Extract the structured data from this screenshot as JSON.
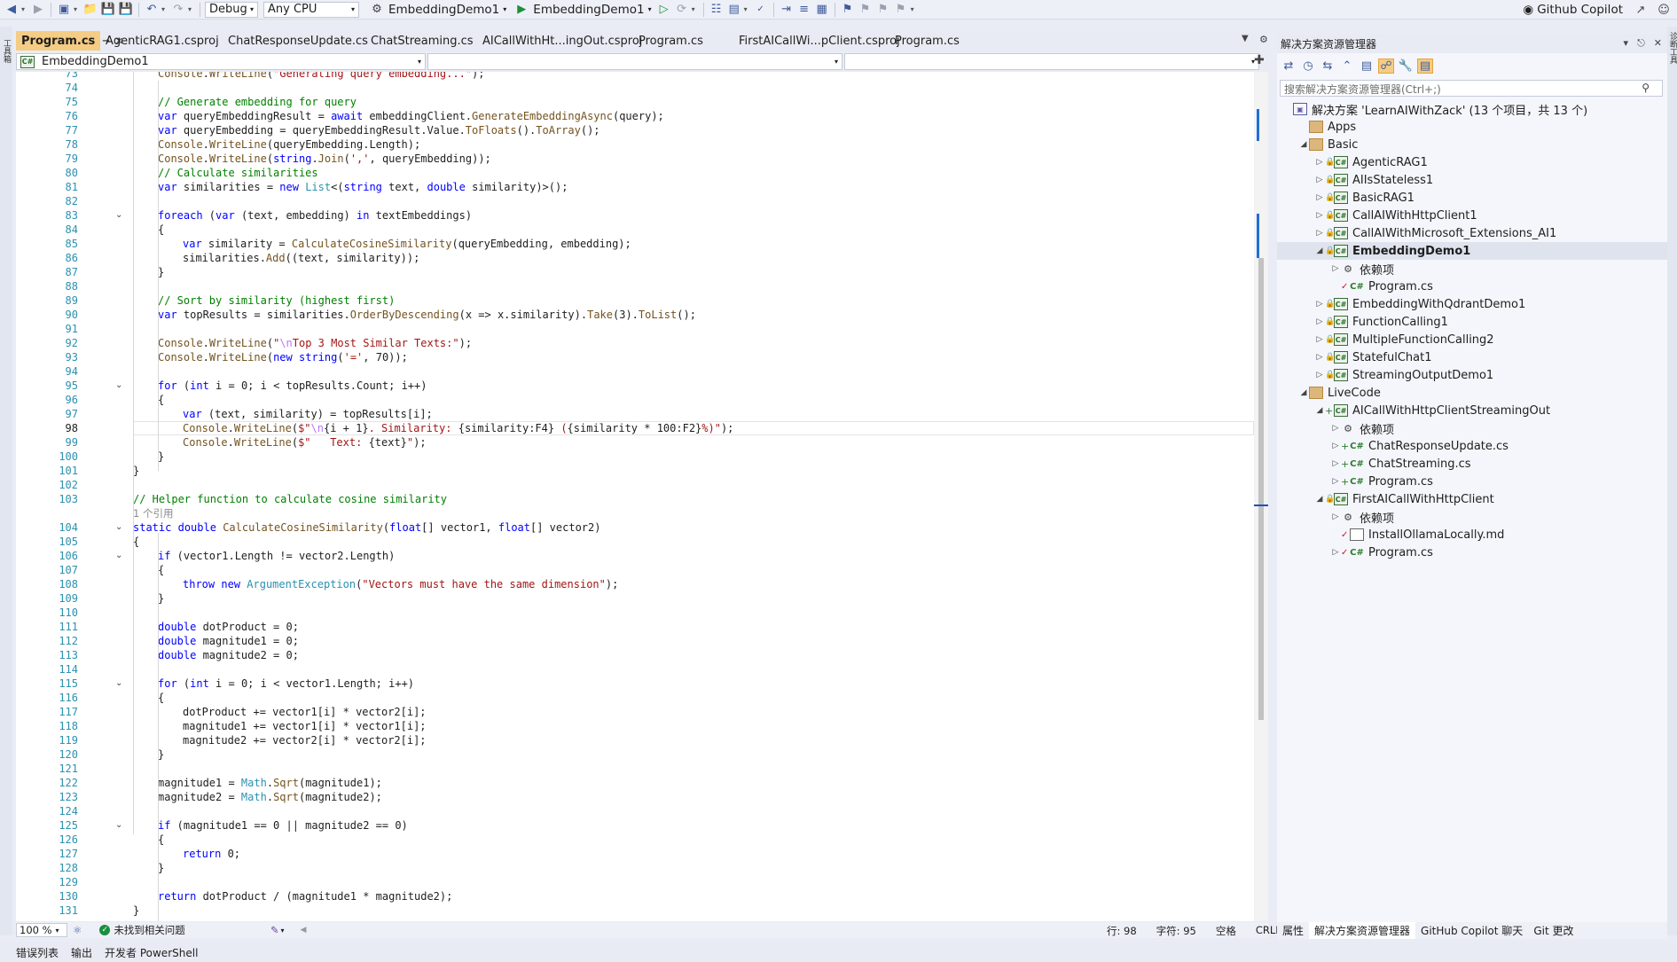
{
  "toolbar": {
    "config": "Debug",
    "platform": "Any CPU",
    "startup_project": "EmbeddingDemo1",
    "run_target": "EmbeddingDemo1",
    "copilot": "Github Copilot"
  },
  "left_strip_label": "工具箱",
  "right_strip_label": "诊断工具",
  "editor": {
    "tabs": [
      {
        "label": "Program.cs",
        "active": true
      },
      {
        "label": "AgenticRAG1.csproj"
      },
      {
        "label": "ChatResponseUpdate.cs"
      },
      {
        "label": "ChatStreaming.cs"
      },
      {
        "label": "AICallWithHt...ingOut.csproj"
      },
      {
        "label": "Program.cs"
      },
      {
        "label": "FirstAICallWi...pClient.csproj"
      },
      {
        "label": "Program.cs"
      }
    ],
    "nav_project": "EmbeddingDemo1",
    "zoom": "100 %",
    "issues": "未找到相关问题",
    "cursor": {
      "line": "行: 98",
      "col": "字符: 95",
      "ws": "空格",
      "eol": "CRLF"
    },
    "current_line": 98,
    "lines": [
      {
        "n": 73,
        "i": 1,
        "c": "<f>Console</f>.<f>WriteLine</f>(<s>\"Generating query embedding...\"</s>);"
      },
      {
        "n": 74,
        "i": 0,
        "c": ""
      },
      {
        "n": 75,
        "i": 1,
        "c": "<c>// Generate embedding for query</c>"
      },
      {
        "n": 76,
        "i": 1,
        "c": "<k>var</k> queryEmbeddingResult = <k>await</k> embeddingClient.<f>GenerateEmbeddingAsync</f>(query);"
      },
      {
        "n": 77,
        "i": 1,
        "c": "<k>var</k> queryEmbedding = queryEmbeddingResult.Value.<f>ToFloats</f>().<f>ToArray</f>();"
      },
      {
        "n": 78,
        "i": 1,
        "c": "<f>Console</f>.<f>WriteLine</f>(queryEmbedding.Length);"
      },
      {
        "n": 79,
        "i": 1,
        "c": "<f>Console</f>.<f>WriteLine</f>(<k>string</k>.<f>Join</f>(<s>','</s>, queryEmbedding));"
      },
      {
        "n": 80,
        "i": 1,
        "c": "<c>// Calculate similarities</c>"
      },
      {
        "n": 81,
        "i": 1,
        "c": "<k>var</k> similarities = <k>new</k> <t>List</t>&lt;(<k>string</k> text, <k>double</k> similarity)&gt;();"
      },
      {
        "n": 82,
        "i": 0,
        "c": ""
      },
      {
        "n": 83,
        "i": 1,
        "c": "<k>foreach</k> (<k>var</k> (text, embedding) <k>in</k> textEmbeddings)",
        "fold": true
      },
      {
        "n": 84,
        "i": 1,
        "c": "{"
      },
      {
        "n": 85,
        "i": 2,
        "c": "<k>var</k> similarity = <f>CalculateCosineSimilarity</f>(queryEmbedding, embedding);"
      },
      {
        "n": 86,
        "i": 2,
        "c": "similarities.<f>Add</f>((text, similarity));"
      },
      {
        "n": 87,
        "i": 1,
        "c": "}"
      },
      {
        "n": 88,
        "i": 0,
        "c": ""
      },
      {
        "n": 89,
        "i": 1,
        "c": "<c>// Sort by similarity (highest first)</c>"
      },
      {
        "n": 90,
        "i": 1,
        "c": "<k>var</k> topResults = similarities.<f>OrderByDescending</f>(x =&gt; x.similarity).<f>Take</f>(3).<f>ToList</f>();"
      },
      {
        "n": 91,
        "i": 0,
        "c": ""
      },
      {
        "n": 92,
        "i": 1,
        "c": "<f>Console</f>.<f>WriteLine</f>(<s>\"<e>\\n</e>Top 3 Most Similar Texts:\"</s>);"
      },
      {
        "n": 93,
        "i": 1,
        "c": "<f>Console</f>.<f>WriteLine</f>(<k>new</k> <k>string</k>(<s>'='</s>, 70));"
      },
      {
        "n": 94,
        "i": 0,
        "c": ""
      },
      {
        "n": 95,
        "i": 1,
        "c": "<k>for</k> (<k>int</k> i = 0; i &lt; topResults.Count; i++)",
        "fold": true
      },
      {
        "n": 96,
        "i": 1,
        "c": "{"
      },
      {
        "n": 97,
        "i": 2,
        "c": "<k>var</k> (text, similarity) = topResults[i];"
      },
      {
        "n": 98,
        "i": 2,
        "c": "<f>Console</f>.<f>WriteLine</f>(<s>$\"<e>\\n</e></s>{i + 1}<s>. Similarity: </s>{similarity:F4}<s> (</s>{similarity * 100:F2}<s>%)\"</s>);"
      },
      {
        "n": 99,
        "i": 2,
        "c": "<f>Console</f>.<f>WriteLine</f>(<s>$\"   Text: </s>{text}<s>\"</s>);"
      },
      {
        "n": 100,
        "i": 1,
        "c": "}"
      },
      {
        "n": 101,
        "i": 0,
        "c": "}"
      },
      {
        "n": 102,
        "i": 0,
        "c": ""
      },
      {
        "n": 103,
        "i": 0,
        "c": "<c>// Helper function to calculate cosine similarity</c>",
        "lens": "1 个引用"
      },
      {
        "n": 104,
        "i": 0,
        "c": "<k>static</k> <k>double</k> <f>CalculateCosineSimilarity</f>(<k>float</k>[] vector1, <k>float</k>[] vector2)",
        "fold": true
      },
      {
        "n": 105,
        "i": 0,
        "c": "{"
      },
      {
        "n": 106,
        "i": 1,
        "c": "<k>if</k> (vector1.Length != vector2.Length)",
        "fold": true
      },
      {
        "n": 107,
        "i": 1,
        "c": "{"
      },
      {
        "n": 108,
        "i": 2,
        "c": "<k>throw</k> <k>new</k> <t>ArgumentException</t>(<s>\"Vectors must have the same dimension\"</s>);"
      },
      {
        "n": 109,
        "i": 1,
        "c": "}"
      },
      {
        "n": 110,
        "i": 0,
        "c": ""
      },
      {
        "n": 111,
        "i": 1,
        "c": "<k>double</k> dotProduct = 0;"
      },
      {
        "n": 112,
        "i": 1,
        "c": "<k>double</k> magnitude1 = 0;"
      },
      {
        "n": 113,
        "i": 1,
        "c": "<k>double</k> magnitude2 = 0;"
      },
      {
        "n": 114,
        "i": 0,
        "c": ""
      },
      {
        "n": 115,
        "i": 1,
        "c": "<k>for</k> (<k>int</k> i = 0; i &lt; vector1.Length; i++)",
        "fold": true
      },
      {
        "n": 116,
        "i": 1,
        "c": "{"
      },
      {
        "n": 117,
        "i": 2,
        "c": "dotProduct += vector1[i] * vector2[i];"
      },
      {
        "n": 118,
        "i": 2,
        "c": "magnitude1 += vector1[i] * vector1[i];"
      },
      {
        "n": 119,
        "i": 2,
        "c": "magnitude2 += vector2[i] * vector2[i];"
      },
      {
        "n": 120,
        "i": 1,
        "c": "}"
      },
      {
        "n": 121,
        "i": 0,
        "c": ""
      },
      {
        "n": 122,
        "i": 1,
        "c": "magnitude1 = <t>Math</t>.<f>Sqrt</f>(magnitude1);"
      },
      {
        "n": 123,
        "i": 1,
        "c": "magnitude2 = <t>Math</t>.<f>Sqrt</f>(magnitude2);"
      },
      {
        "n": 124,
        "i": 0,
        "c": ""
      },
      {
        "n": 125,
        "i": 1,
        "c": "<k>if</k> (magnitude1 == 0 || magnitude2 == 0)",
        "fold": true
      },
      {
        "n": 126,
        "i": 1,
        "c": "{"
      },
      {
        "n": 127,
        "i": 2,
        "c": "<k>return</k> 0;"
      },
      {
        "n": 128,
        "i": 1,
        "c": "}"
      },
      {
        "n": 129,
        "i": 0,
        "c": ""
      },
      {
        "n": 130,
        "i": 1,
        "c": "<k>return</k> dotProduct / (magnitude1 * magnitude2);"
      },
      {
        "n": 131,
        "i": 0,
        "c": "}"
      }
    ]
  },
  "solution_explorer": {
    "title": "解决方案资源管理器",
    "search_placeholder": "搜索解决方案资源管理器(Ctrl+;)",
    "nodes": [
      {
        "label": "解决方案 'LearnAIWithZack' (13 个项目，共 13 个)",
        "level": 0,
        "kind": "sln",
        "exp": ""
      },
      {
        "label": "Apps",
        "level": 1,
        "kind": "folder",
        "exp": ""
      },
      {
        "label": "Basic",
        "level": 1,
        "kind": "folder",
        "exp": "open"
      },
      {
        "label": "AgenticRAG1",
        "level": 2,
        "kind": "proj",
        "exp": "closed",
        "lock": true
      },
      {
        "label": "AIIsStateless1",
        "level": 2,
        "kind": "proj",
        "exp": "closed",
        "lock": true
      },
      {
        "label": "BasicRAG1",
        "level": 2,
        "kind": "proj",
        "exp": "closed",
        "lock": true
      },
      {
        "label": "CallAIWithHttpClient1",
        "level": 2,
        "kind": "proj",
        "exp": "closed",
        "lock": true
      },
      {
        "label": "CallAIWithMicrosoft_Extensions_AI1",
        "level": 2,
        "kind": "proj",
        "exp": "closed",
        "lock": true
      },
      {
        "label": "EmbeddingDemo1",
        "level": 2,
        "kind": "proj",
        "exp": "open",
        "lock": true,
        "sel": true
      },
      {
        "label": "依赖项",
        "level": 3,
        "kind": "deps",
        "exp": "closed"
      },
      {
        "label": "Program.cs",
        "level": 3,
        "kind": "cs",
        "exp": "",
        "mark": "chk"
      },
      {
        "label": "EmbeddingWithQdrantDemo1",
        "level": 2,
        "kind": "proj",
        "exp": "closed",
        "lock": true
      },
      {
        "label": "FunctionCalling1",
        "level": 2,
        "kind": "proj",
        "exp": "closed",
        "lock": true
      },
      {
        "label": "MultipleFunctionCalling2",
        "level": 2,
        "kind": "proj",
        "exp": "closed",
        "lock": true
      },
      {
        "label": "StatefulChat1",
        "level": 2,
        "kind": "proj",
        "exp": "closed",
        "lock": true
      },
      {
        "label": "StreamingOutputDemo1",
        "level": 2,
        "kind": "proj",
        "exp": "closed",
        "lock": true
      },
      {
        "label": "LiveCode",
        "level": 1,
        "kind": "folder",
        "exp": "open"
      },
      {
        "label": "AICallWithHttpClientStreamingOut",
        "level": 2,
        "kind": "proj",
        "exp": "open",
        "mark": "plus"
      },
      {
        "label": "依赖项",
        "level": 3,
        "kind": "deps",
        "exp": "closed"
      },
      {
        "label": "ChatResponseUpdate.cs",
        "level": 3,
        "kind": "cs",
        "exp": "closed",
        "mark": "plus"
      },
      {
        "label": "ChatStreaming.cs",
        "level": 3,
        "kind": "cs",
        "exp": "closed",
        "mark": "plus"
      },
      {
        "label": "Program.cs",
        "level": 3,
        "kind": "cs",
        "exp": "closed",
        "mark": "plus"
      },
      {
        "label": "FirstAICallWithHttpClient",
        "level": 2,
        "kind": "proj",
        "exp": "open",
        "lock": true
      },
      {
        "label": "依赖项",
        "level": 3,
        "kind": "deps",
        "exp": "closed"
      },
      {
        "label": "InstallOllamaLocally.md",
        "level": 3,
        "kind": "md",
        "exp": "",
        "mark": "chk"
      },
      {
        "label": "Program.cs",
        "level": 3,
        "kind": "cs",
        "exp": "closed",
        "mark": "chk"
      }
    ],
    "bottom_tabs": [
      {
        "label": "属性"
      },
      {
        "label": "解决方案资源管理器",
        "active": true
      },
      {
        "label": "GitHub Copilot 聊天"
      },
      {
        "label": "Git 更改"
      }
    ]
  },
  "statusbar": {
    "items": [
      "错误列表",
      "输出",
      "开发者 PowerShell"
    ]
  }
}
